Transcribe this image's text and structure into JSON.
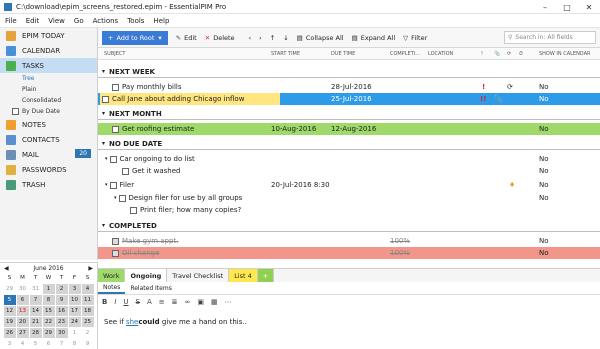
{
  "window": {
    "title": "C:\\download\\epim_screens_restored.epim - EssentialPIM Pro"
  },
  "menu": [
    "File",
    "Edit",
    "View",
    "Go",
    "Actions",
    "Tools",
    "Help"
  ],
  "sidebar": {
    "items": [
      {
        "label": "EPIM TODAY"
      },
      {
        "label": "CALENDAR"
      },
      {
        "label": "TASKS"
      },
      {
        "label": "NOTES"
      },
      {
        "label": "CONTACTS"
      },
      {
        "label": "MAIL",
        "badge": "20"
      },
      {
        "label": "PASSWORDS"
      },
      {
        "label": "TRASH"
      }
    ],
    "task_views": [
      "Tree",
      "Plain",
      "Consolidated",
      "By Due Date"
    ]
  },
  "calendar": {
    "month": "June 2016",
    "weekdays": [
      "S",
      "M",
      "T",
      "W",
      "T",
      "F",
      "S"
    ],
    "days": [
      [
        "29",
        "30",
        "31",
        "1",
        "2",
        "3",
        "4"
      ],
      [
        "5",
        "6",
        "7",
        "8",
        "9",
        "10",
        "11"
      ],
      [
        "12",
        "13",
        "14",
        "15",
        "16",
        "17",
        "18"
      ],
      [
        "19",
        "20",
        "21",
        "22",
        "23",
        "24",
        "25"
      ],
      [
        "26",
        "27",
        "28",
        "29",
        "30",
        "1",
        "2"
      ],
      [
        "3",
        "4",
        "5",
        "6",
        "7",
        "8",
        "9"
      ]
    ],
    "today": "5"
  },
  "toolbar": {
    "add": "Add to Root",
    "edit": "Edit",
    "delete": "Delete",
    "collapse": "Collapse All",
    "expand": "Expand All",
    "filter": "Filter",
    "search_placeholder": "Search in: All fields"
  },
  "columns": {
    "subject": "SUBJECT",
    "start": "START TIME",
    "due": "DUE TIME",
    "completion": "COMPLETI...",
    "location": "LOCATION",
    "show": "SHOW IN CALENDAR"
  },
  "groups": {
    "next_week": "NEXT WEEK",
    "next_month": "NEXT MONTH",
    "no_due": "NO DUE DATE",
    "completed": "COMPLETED"
  },
  "tasks": {
    "t1": {
      "subject": "Pay monthly bills",
      "due": "28-Jul-2016",
      "flag": "!",
      "show": "No"
    },
    "t2": {
      "subject": "Call Jane about adding Chicago inflow",
      "due": "25-Jul-2016",
      "flag": "!!",
      "show": "No"
    },
    "t3": {
      "subject": "Get roofing estimate",
      "start": "10-Aug-2016",
      "due": "12-Aug-2016",
      "show": "No"
    },
    "t4": {
      "subject": "Car ongoing to do list",
      "show": "No"
    },
    "t5": {
      "subject": "Get it washed",
      "show": "No"
    },
    "t6": {
      "subject": "Filer",
      "start": "20-Jul-2016 8:30",
      "show": "No"
    },
    "t7": {
      "subject": "Design filer for use by all groups",
      "show": "No"
    },
    "t8": {
      "subject": "Print filer; how many copies?",
      "show": "No"
    },
    "t9": {
      "subject": "Make gym appt.",
      "completion": "100%",
      "show": "No"
    },
    "t10": {
      "subject": "Oil change",
      "completion": "100%",
      "show": "No"
    }
  },
  "bottom_tabs": [
    "Work",
    "Ongoing",
    "Travel Checklist",
    "List 4",
    "+"
  ],
  "sub_tabs": [
    "Notes",
    "Related Items"
  ],
  "notes": {
    "pre": "See if ",
    "link": "she",
    "bold": "could",
    "post": " give me a hand on this.."
  }
}
